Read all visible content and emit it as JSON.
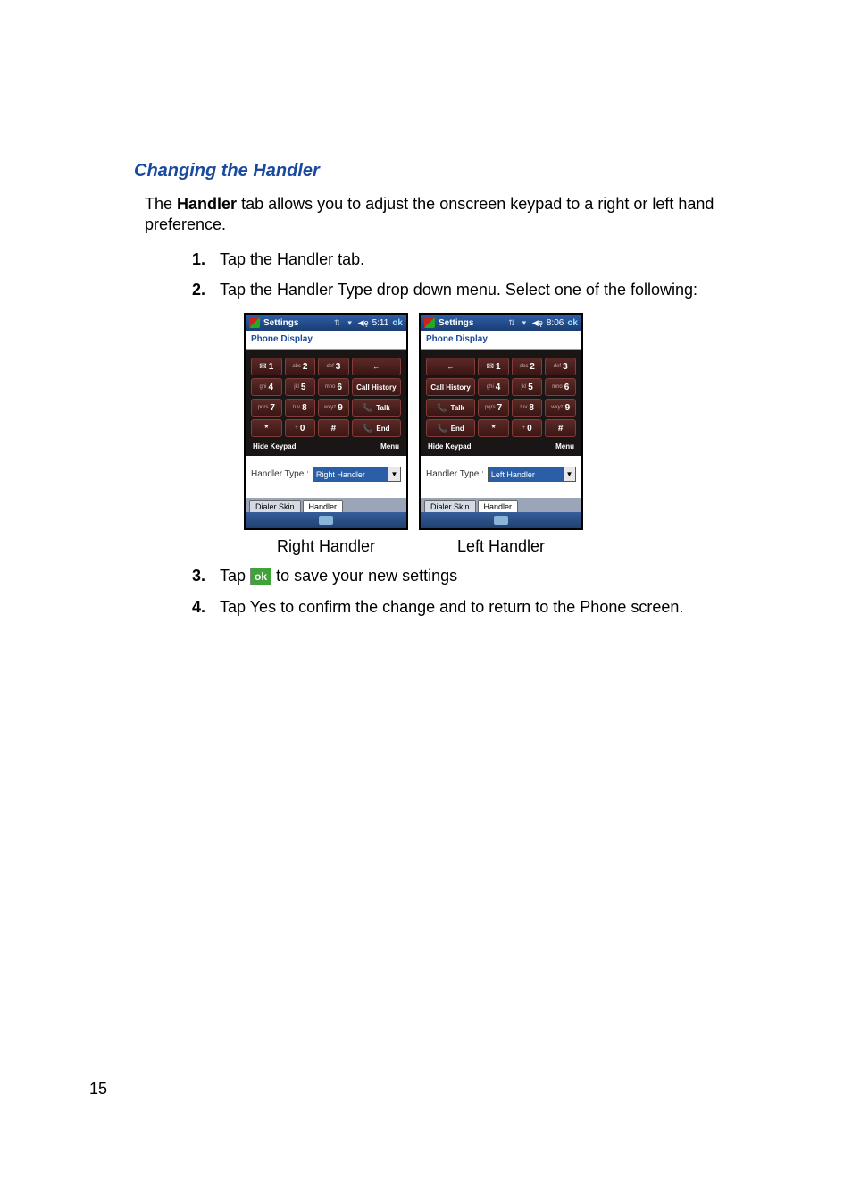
{
  "page_number": "15",
  "heading": "Changing the Handler",
  "intro": {
    "pre": "The ",
    "bold": "Handler",
    "post": " tab allows you to adjust the onscreen keypad to a right or left hand preference."
  },
  "steps": {
    "s1": {
      "num": "1.",
      "pre": "Tap the ",
      "bold": "Handler",
      "post": " tab."
    },
    "s2": {
      "num": "2.",
      "pre": "Tap the ",
      "bold": "Handler Type",
      "post": " drop down menu. Select one of the following:"
    },
    "s3": {
      "num": "3.",
      "pre": "Tap ",
      "ok": "ok",
      "post": " to save your new settings"
    },
    "s4": {
      "num": "4.",
      "pre": "Tap ",
      "bold1": "Yes",
      "mid": " to confirm the change and to return to the ",
      "bold2": "Phone",
      "post": " screen."
    }
  },
  "captions": {
    "right": "Right Handler",
    "left": "Left Handler"
  },
  "screens": {
    "right": {
      "title": "Settings",
      "time": "5:11",
      "ok": "ok",
      "header": "Phone Display",
      "htype_label": "Handler Type :",
      "htype_value": "Right Handler",
      "tab1": "Dialer Skin",
      "tab2": "Handler",
      "bottom_hide": "Hide Keypad",
      "bottom_menu": "Menu"
    },
    "left": {
      "title": "Settings",
      "time": "8:06",
      "ok": "ok",
      "header": "Phone Display",
      "htype_label": "Handler Type :",
      "htype_value": "Left Handler",
      "tab1": "Dialer Skin",
      "tab2": "Handler",
      "bottom_hide": "Hide Keypad",
      "bottom_menu": "Menu"
    }
  },
  "keys": {
    "d1": "1",
    "d2": "2",
    "d3": "3",
    "d4": "4",
    "d5": "5",
    "d6": "6",
    "d7": "7",
    "d8": "8",
    "d9": "9",
    "dstar": "*",
    "d0": "0",
    "dhash": "#",
    "l2": "abc",
    "l3": "def",
    "l4": "ghi",
    "l5": "jkl",
    "l6": "mno",
    "l7": "pqrs",
    "l8": "tuv",
    "l9": "wxyz",
    "lstar": "",
    "l0": "+",
    "lhash": "",
    "f_back": "←",
    "f_callhistory": "Call History",
    "f_talk": "Talk",
    "f_end": "End",
    "f_talk_icon": "📞",
    "f_end_icon": "📞"
  }
}
